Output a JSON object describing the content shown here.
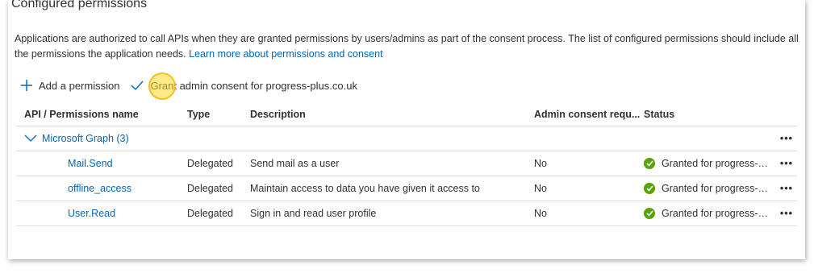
{
  "section": {
    "title": "Configured permissions",
    "description": "Applications are authorized to call APIs when they are granted permissions by users/admins as part of the consent process. The list of configured permissions should include all the permissions the application needs.",
    "learn_more_link": "Learn more about permissions and consent"
  },
  "toolbar": {
    "add_permission_label": "Add a permission",
    "grant_consent_label": "Grant admin consent for progress-plus.co.uk"
  },
  "table": {
    "headers": {
      "api": "API / Permissions name",
      "type": "Type",
      "description": "Description",
      "admin_consent": "Admin consent requ...",
      "status": "Status"
    },
    "group": {
      "label": "Microsoft Graph (3)",
      "more": "•••"
    },
    "rows": [
      {
        "name": "Mail.Send",
        "type": "Delegated",
        "description": "Send mail as a user",
        "admin_consent": "No",
        "status": "Granted for progress-pl...",
        "status_icon": "check-circle-icon",
        "more": "•••"
      },
      {
        "name": "offline_access",
        "type": "Delegated",
        "description": "Maintain access to data you have given it access to",
        "admin_consent": "No",
        "status": "Granted for progress-pl...",
        "status_icon": "check-circle-icon",
        "more": "•••"
      },
      {
        "name": "User.Read",
        "type": "Delegated",
        "description": "Sign in and read user profile",
        "admin_consent": "No",
        "status": "Granted for progress-pl...",
        "status_icon": "check-circle-icon",
        "more": "•••"
      }
    ]
  },
  "colors": {
    "link": "#0067b8",
    "granted": "#57a300",
    "cursor_highlight": "#ffd728"
  }
}
